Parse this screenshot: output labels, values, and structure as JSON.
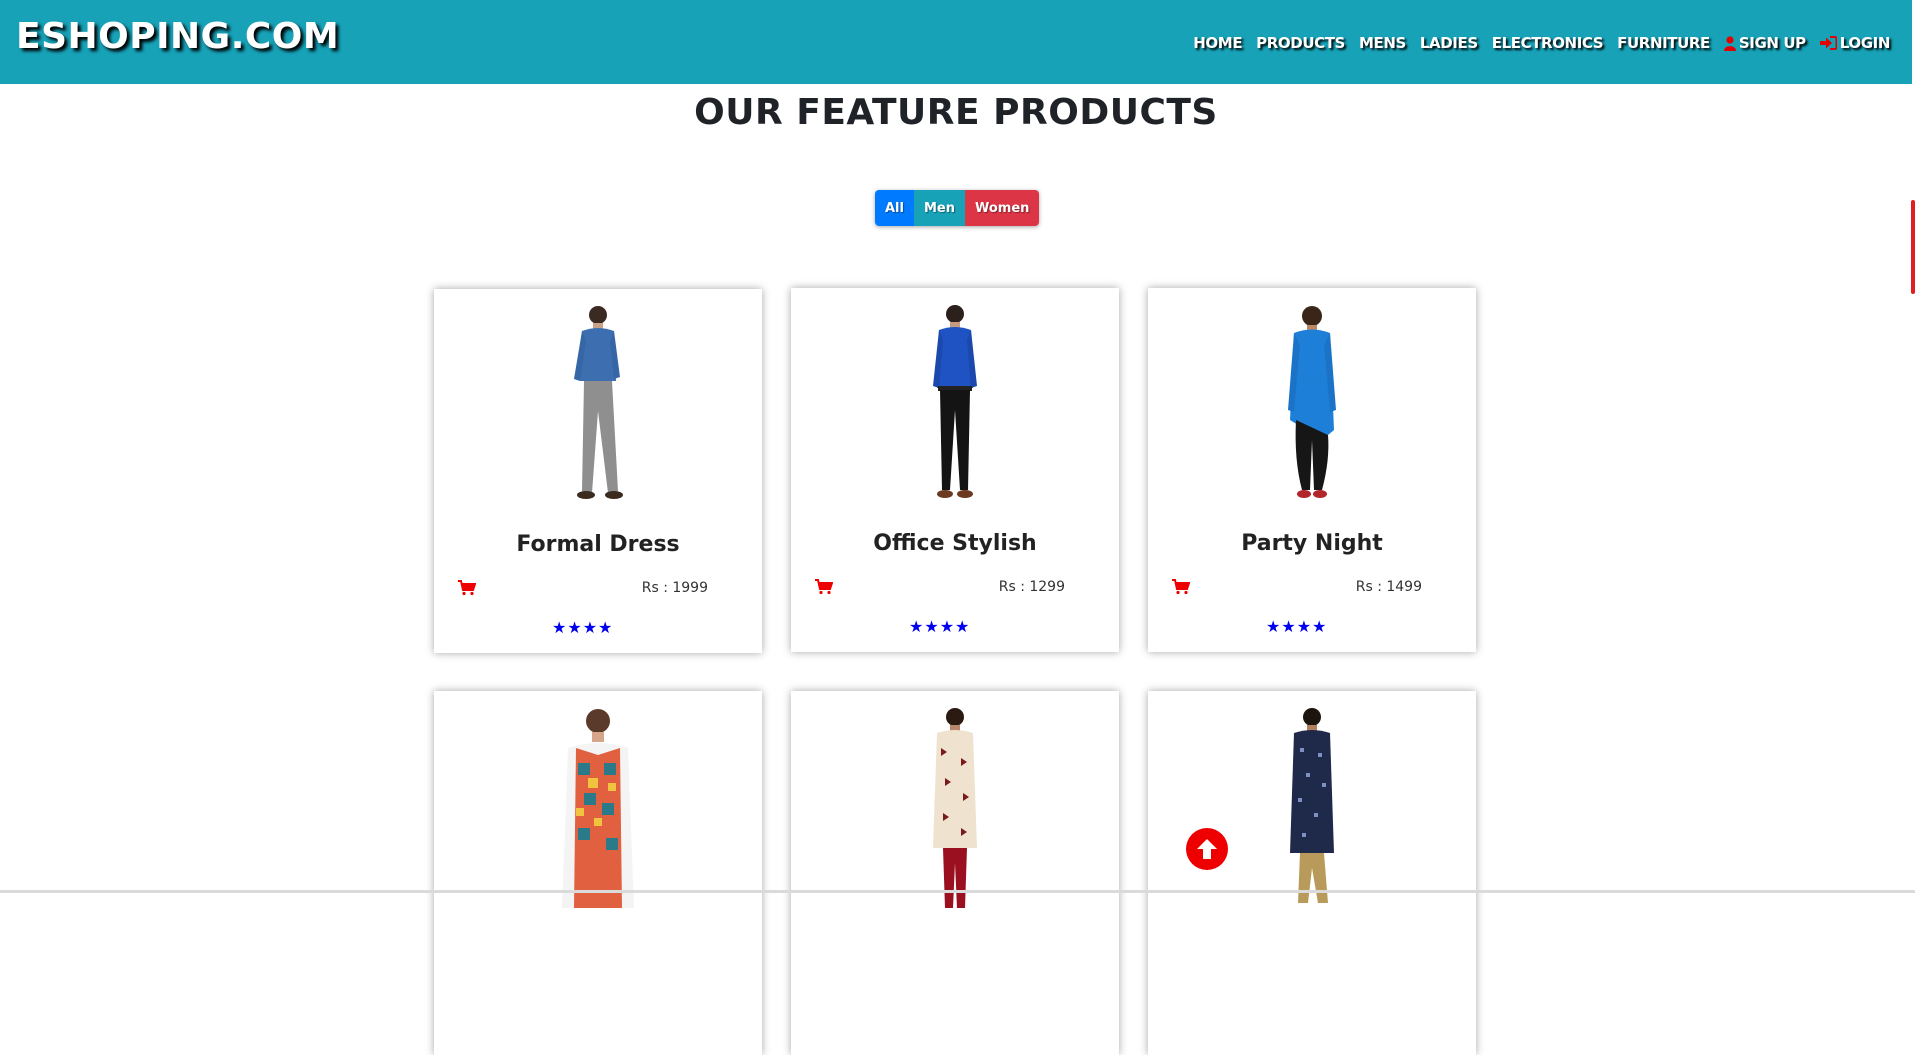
{
  "brand": "ESHOPING.COM",
  "nav": {
    "home": "HOME",
    "products": "PRODUCTS",
    "mens": "MENS",
    "ladies": "LADIES",
    "electronics": "ELECTRONICS",
    "furniture": "FURNITURE",
    "signup": "SIGN UP",
    "login": "LOGIN"
  },
  "section_title": "OUR FEATURE PRODUCTS",
  "filters": {
    "all": "All",
    "men": "Men",
    "women": "Women"
  },
  "products": [
    {
      "name": "Formal Dress",
      "price": "Rs : 1999",
      "rating": 4
    },
    {
      "name": "Office Stylish",
      "price": "Rs : 1299",
      "rating": 4
    },
    {
      "name": "Party Night",
      "price": "Rs : 1499",
      "rating": 4
    },
    {
      "name": "",
      "price": "",
      "rating": 0
    },
    {
      "name": "",
      "price": "",
      "rating": 0
    },
    {
      "name": "",
      "price": "",
      "rating": 0
    }
  ],
  "colors": {
    "navbar": "#17a2b8",
    "filter_all": "#007bff",
    "filter_men": "#17a2b8",
    "filter_women": "#dc3545",
    "stars": "#0000ee",
    "cart": "#e00000"
  },
  "icons": {
    "cart": "shopping-cart-icon",
    "user": "user-icon",
    "login": "sign-in-icon",
    "scroll_up": "arrow-circle-up-icon"
  }
}
